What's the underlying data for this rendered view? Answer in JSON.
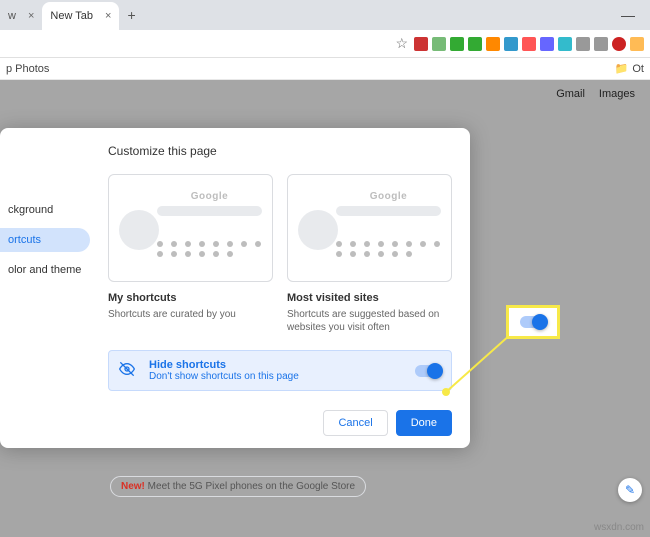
{
  "browser": {
    "tabs": [
      {
        "title": "w",
        "close": "×"
      },
      {
        "title": "New Tab",
        "close": "×"
      }
    ],
    "newtab_plus": "+",
    "window_min": "—",
    "bookmark_left": "p Photos",
    "bookmark_right": "Ot"
  },
  "page": {
    "header_gmail": "Gmail",
    "header_images": "Images"
  },
  "dialog": {
    "title": "Customize this page",
    "sidebar": {
      "background": "ckground",
      "shortcuts": "ortcuts",
      "color": "olor and theme"
    },
    "option_my": {
      "preview_logo": "Google",
      "title": "My shortcuts",
      "desc": "Shortcuts are curated by you"
    },
    "option_most": {
      "preview_logo": "Google",
      "title": "Most visited sites",
      "desc": "Shortcuts are suggested based on websites you visit often"
    },
    "hide": {
      "title": "Hide shortcuts",
      "desc": "Don't show shortcuts on this page"
    },
    "cancel": "Cancel",
    "done": "Done"
  },
  "promo": {
    "new": "New!",
    "text": " Meet the 5G Pixel phones on the Google Store"
  },
  "watermark": "wsxdn.com"
}
